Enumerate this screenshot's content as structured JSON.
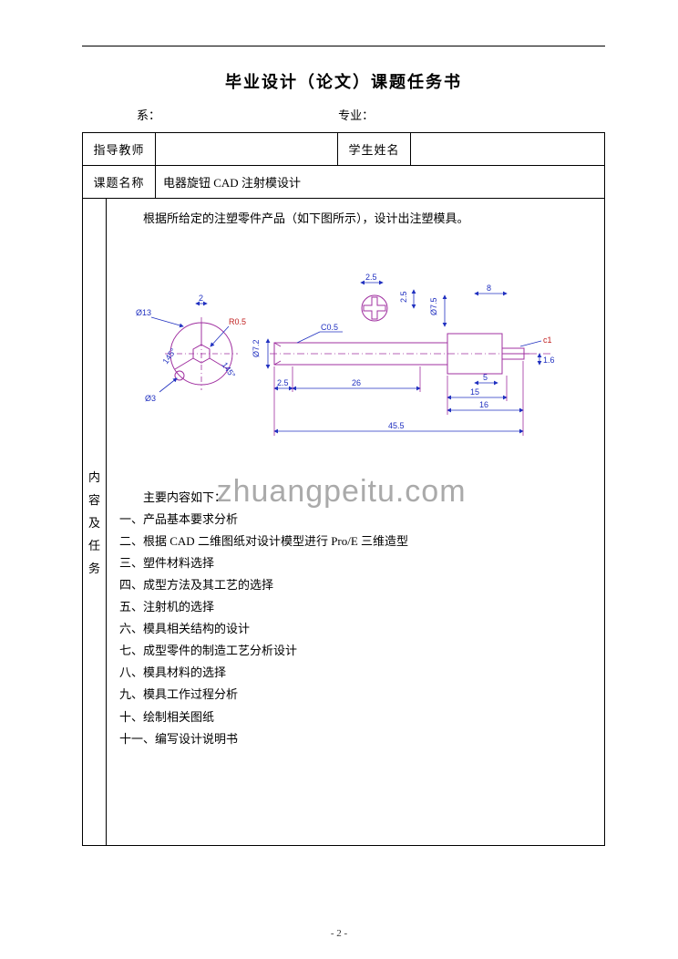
{
  "title": "毕业设计（论文）课题任务书",
  "dept_label": "系：",
  "major_label": "专业：",
  "row1": {
    "advisor_label": "指导教师",
    "advisor_value": "",
    "student_label": "学生姓名",
    "student_value": ""
  },
  "row2": {
    "topic_label": "课题名称",
    "topic_value": "电器旋钮 CAD 注射模设计"
  },
  "side_label": [
    "内",
    "容",
    "及",
    "任",
    "务"
  ],
  "intro": "根据所给定的注塑零件产品（如下图所示），设计出注塑模具。",
  "watermark": "zhuangpeitu.com",
  "list_header": "主要内容如下：",
  "items": [
    "一、产品基本要求分析",
    "二、根据 CAD 二维图纸对设计模型进行 Pro/E 三维造型",
    "三、塑件材料选择",
    "四、成型方法及其工艺的选择",
    "五、注射机的选择",
    "六、模具相关结构的设计",
    "七、成型零件的制造工艺分析设计",
    "八、模具材料的选择",
    "九、模具工作过程分析",
    "十、绘制相关图纸",
    "十一、编写设计说明书"
  ],
  "page_number": "- 2 -",
  "drawing_dims": {
    "d13": "Ø13",
    "d3": "Ø3",
    "ang145a": "145°",
    "ang145b": "145°",
    "r05": "R0.5",
    "t2": "2",
    "d72": "Ø7.2",
    "c05": "C0.5",
    "t25a": "2.5",
    "t25b": "2.5",
    "t25c": "2.5",
    "len26": "26",
    "d75": "Ø7.5",
    "len8": "8",
    "c1": "c1",
    "t5": "5",
    "t16": "1.6",
    "len15": "15",
    "len16": "16",
    "len455": "45.5"
  }
}
